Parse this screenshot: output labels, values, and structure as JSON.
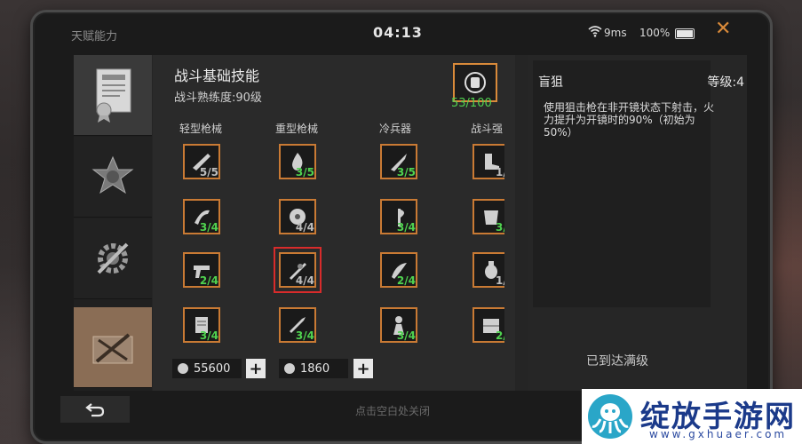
{
  "status": {
    "title": "天赋能力",
    "time": "04:13",
    "ping": "9ms",
    "battery": "100%"
  },
  "main": {
    "title": "战斗基础技能",
    "subtitle": "战斗熟练度:90级",
    "badge_count": "53/100",
    "categories": [
      "轻型枪械",
      "重型枪械",
      "冷兵器",
      "战斗强"
    ],
    "skills": [
      [
        "5/5",
        "3/4",
        "2/4",
        "3/4"
      ],
      [
        "3/5",
        "4/4",
        "4/4",
        "3/4"
      ],
      [
        "3/5",
        "3/4",
        "2/4",
        "3/4"
      ],
      [
        "1/",
        "3/",
        "1/",
        "2/"
      ]
    ],
    "currency_gold": "55600",
    "currency_silver": "1860"
  },
  "detail": {
    "name": "盲狙",
    "level": "等级:4",
    "description": "使用狙击枪在非开镜状态下射击，火力提升为开镜时的90%（初始为50%）",
    "max_label": "已到达满级"
  },
  "bottom": {
    "hint": "点击空白处关闭"
  },
  "watermark": {
    "text": "绽放手游网",
    "url": "www.gxhuaer.com"
  },
  "colors": {
    "accent": "#d98a3a",
    "progress_green": "#4fd24f",
    "highlight_red": "#d82b2b",
    "selected_tab": "#8a6d55"
  }
}
